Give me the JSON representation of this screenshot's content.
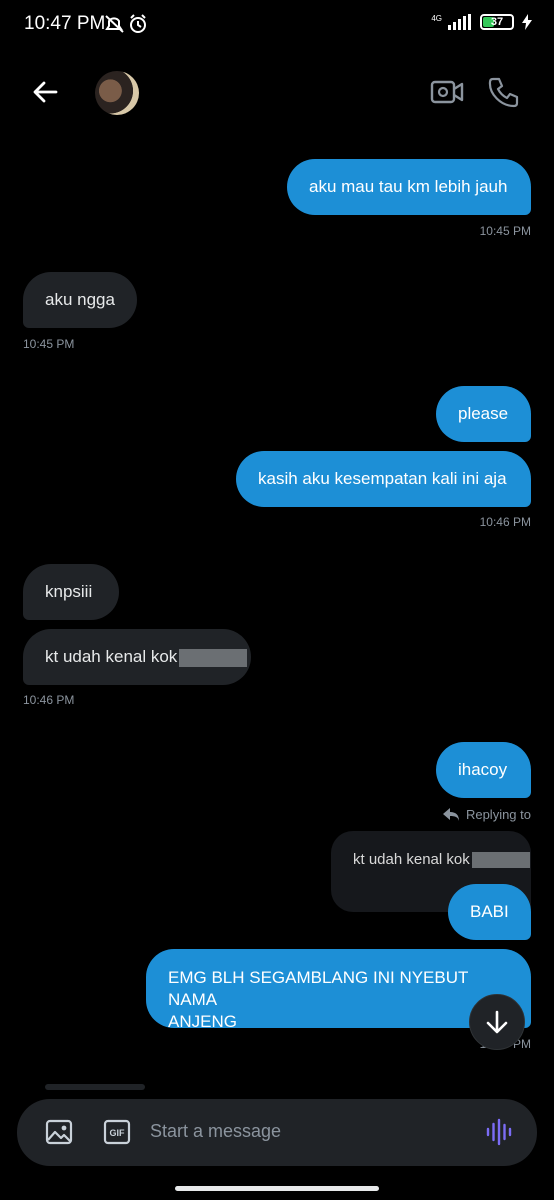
{
  "status_bar": {
    "time": "10:47 PM",
    "network": "4G",
    "battery": "37"
  },
  "header": {
    "avatar_alt": "contact avatar"
  },
  "messages": [
    {
      "text": "aku mau tau km lebih jauh"
    },
    {
      "time": "10:45 PM"
    },
    {
      "text": "aku ngga"
    },
    {
      "time": "10:45 PM"
    },
    {
      "text": "please"
    },
    {
      "text": "kasih aku kesempatan kali ini aja"
    },
    {
      "time": "10:46 PM"
    },
    {
      "text": "knpsiii"
    },
    {
      "text": "kt udah kenal kok"
    },
    {
      "time": "10:46 PM"
    },
    {
      "text": "ihacoy"
    },
    {
      "reply_label": "Replying to"
    },
    {
      "text": "kt udah kenal kok"
    },
    {
      "text": "BABI"
    },
    {
      "text": "EMG BLH SEGAMBLANG INI NYEBUT NAMA",
      "text2": "ANJENG"
    },
    {
      "time": "10:47 PM"
    }
  ],
  "composer": {
    "placeholder": "Start a message"
  },
  "colors": {
    "sent": "#1d8fd6",
    "received": "#202327",
    "background": "#000000",
    "voice": "#7b6cf6"
  }
}
